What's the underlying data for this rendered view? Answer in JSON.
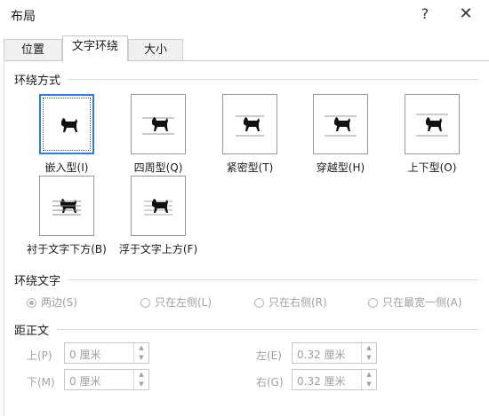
{
  "window": {
    "title": "布局",
    "help_glyph": "?",
    "close_glyph": "✕"
  },
  "tabs": [
    {
      "label": "位置"
    },
    {
      "label": "文字环绕"
    },
    {
      "label": "大小"
    }
  ],
  "wrapping_style": {
    "section_label": "环绕方式",
    "selected_index": 0,
    "options": [
      {
        "label": "嵌入型(I)",
        "icon": "inline-wrap-icon"
      },
      {
        "label": "四周型(Q)",
        "icon": "square-wrap-icon"
      },
      {
        "label": "紧密型(T)",
        "icon": "tight-wrap-icon"
      },
      {
        "label": "穿越型(H)",
        "icon": "through-wrap-icon"
      },
      {
        "label": "上下型(O)",
        "icon": "top-bottom-wrap-icon"
      },
      {
        "label": "衬于文字下方(B)",
        "icon": "behind-text-icon"
      },
      {
        "label": "浮于文字上方(F)",
        "icon": "in-front-text-icon"
      }
    ]
  },
  "wrap_text": {
    "section_label": "环绕文字",
    "options": [
      {
        "label": "两边(S)",
        "checked": true
      },
      {
        "label": "只在左侧(L)",
        "checked": false
      },
      {
        "label": "只在右侧(R)",
        "checked": false
      },
      {
        "label": "只在最宽一侧(A)",
        "checked": false
      }
    ]
  },
  "distance": {
    "section_label": "距正文",
    "top": {
      "label": "上(P)",
      "value": "0 厘米"
    },
    "bottom": {
      "label": "下(M)",
      "value": "0 厘米"
    },
    "left": {
      "label": "左(E)",
      "value": "0.32 厘米"
    },
    "right": {
      "label": "右(G)",
      "value": "0.32 厘米"
    }
  },
  "colors": {
    "accent": "#2b7de0",
    "disabled_text": "#a0a0a0",
    "border": "#c8c8c8"
  }
}
